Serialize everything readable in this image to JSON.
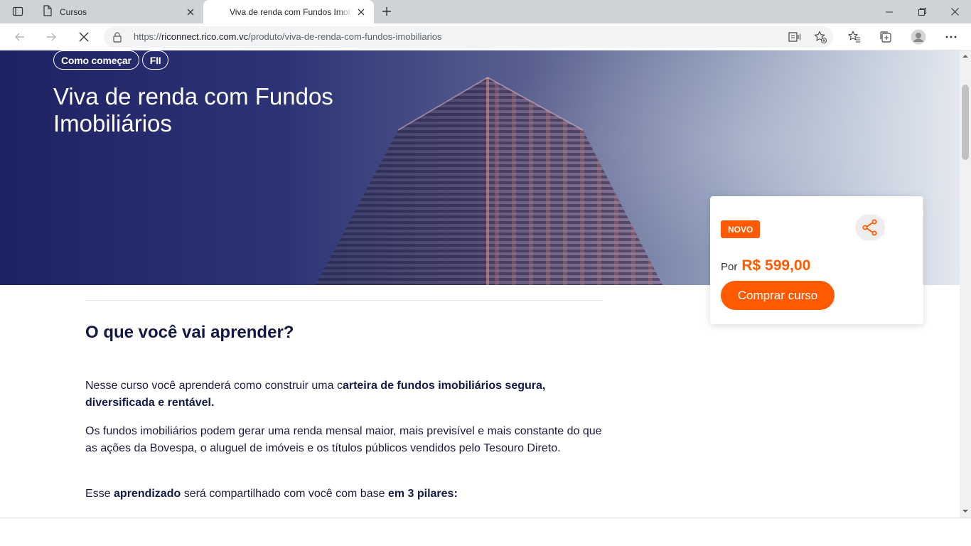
{
  "browser": {
    "tabs": [
      {
        "title": "Cursos",
        "icon": "page-icon"
      },
      {
        "title": "Viva de renda com Fundos Imobiliários",
        "icon": "none",
        "active": true
      }
    ],
    "url_prefix": "https://",
    "url_host": "riconnect.rico.com.vc",
    "url_path": "/produto/viva-de-renda-com-fundos-imobiliarios"
  },
  "hero": {
    "tags": [
      "Como começar",
      "FII"
    ],
    "title": "Viva de renda com Fundos Imobiliários"
  },
  "purchase_card": {
    "badge": "NOVO",
    "price_prefix": "Por",
    "price": "R$ 599,00",
    "buy_label": "Comprar curso"
  },
  "content": {
    "section_title": "O que você vai aprender?",
    "p1_a": "Nesse curso você aprenderá como construir uma c",
    "p1_b": "arteira de fundos imobiliários segura, diversificada e rentável.",
    "p2": "Os fundos imobiliários podem gerar uma renda mensal maior, mais previsível e mais constante do que as ações da Bovespa, o aluguel de imóveis e os títulos públicos vendidos pelo Tesouro Direto.",
    "p3_a": "Esse ",
    "p3_b": "aprendizado",
    "p3_c": " será compartilhado com você com base ",
    "p3_d": "em 3 pilares:"
  },
  "colors": {
    "accent": "#ff5a00",
    "heading": "#141845",
    "hero_dark": "#1d2262"
  }
}
